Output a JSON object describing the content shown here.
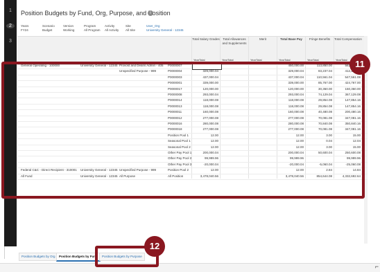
{
  "window": {
    "title": "Position Budgets by Fund, Org, Purpose, and Position"
  },
  "row_numbers": [
    "1",
    "2",
    "3"
  ],
  "pov": [
    {
      "h": "Years",
      "v": "FY24"
    },
    {
      "h": "Scenario",
      "v": "Budget"
    },
    {
      "h": "Version",
      "v": "Working"
    },
    {
      "h": "Program",
      "v": "All Program"
    },
    {
      "h": "Activity",
      "v": "All Activity"
    },
    {
      "h": "Site",
      "v": "All Site"
    },
    {
      "h": "User_Org",
      "v": "University General - 12345"
    }
  ],
  "columns": [
    {
      "label": "Total Salary Grades",
      "sub": "YearTotal"
    },
    {
      "label": "Total Allowances and Supplements",
      "sub": "YearTotal"
    },
    {
      "label": "Merit",
      "sub": "YearTotal"
    },
    {
      "label": "Total Base Pay",
      "sub": "YearTotal"
    },
    {
      "label": "Fringe Benefits",
      "sub": "YearTotal"
    },
    {
      "label": "Total Compensation",
      "sub": "YearTotal"
    }
  ],
  "rows": [
    {
      "fund": "General Operating - 100000",
      "org": "University General - 12345",
      "purpose": "Provost and Deans Admin - 405",
      "pos": "P0000007",
      "v": [
        "450,000",
        "",
        "",
        "450,000.00",
        "113,850.00",
        "563,850.00"
      ]
    },
    {
      "fund": "",
      "org": "",
      "purpose": "Unspecified Purpose - 999",
      "pos": "P0000004",
      "v": [
        "329,000.04",
        "",
        "",
        "329,000.04",
        "83,237.04",
        "412,237.08"
      ]
    },
    {
      "fund": "",
      "org": "",
      "purpose": "",
      "pos": "P0000003",
      "v": [
        "437,000.04",
        "",
        "",
        "437,000.04",
        "110,561.04",
        "547,561.08"
      ]
    },
    {
      "fund": "",
      "org": "",
      "purpose": "",
      "pos": "P0000001",
      "v": [
        "339,000.00",
        "",
        "",
        "339,000.00",
        "85,767.00",
        "424,767.00"
      ]
    },
    {
      "fund": "",
      "org": "",
      "purpose": "",
      "pos": "P0000017",
      "v": [
        "120,000.00",
        "",
        "",
        "120,000.00",
        "30,360.00",
        "150,360.00"
      ]
    },
    {
      "fund": "",
      "org": "",
      "purpose": "",
      "pos": "P0000008",
      "v": [
        "293,000.04",
        "",
        "",
        "293,000.04",
        "74,129.04",
        "367,129.08"
      ]
    },
    {
      "fund": "",
      "org": "",
      "purpose": "",
      "pos": "P0000014",
      "v": [
        "118,000.08",
        "",
        "",
        "118,000.08",
        "29,854.08",
        "147,854.16"
      ]
    },
    {
      "fund": "",
      "org": "",
      "purpose": "",
      "pos": "P0000013",
      "v": [
        "118,000.08",
        "",
        "",
        "118,000.08",
        "29,854.08",
        "147,854.16"
      ]
    },
    {
      "fund": "",
      "org": "",
      "purpose": "",
      "pos": "P0000011",
      "v": [
        "160,000.08",
        "",
        "",
        "160,000.08",
        "40,480.08",
        "200,480.16"
      ]
    },
    {
      "fund": "",
      "org": "",
      "purpose": "",
      "pos": "P0000012",
      "v": [
        "277,000.08",
        "",
        "",
        "277,000.08",
        "70,081.08",
        "347,081.16"
      ]
    },
    {
      "fund": "",
      "org": "",
      "purpose": "",
      "pos": "P0000016",
      "v": [
        "280,000.08",
        "",
        "",
        "280,000.08",
        "70,840.08",
        "350,840.16"
      ]
    },
    {
      "fund": "",
      "org": "",
      "purpose": "",
      "pos": "P0000018",
      "v": [
        "277,000.08",
        "",
        "",
        "277,000.08",
        "70,081.08",
        "347,081.16"
      ]
    },
    {
      "fund": "",
      "org": "",
      "purpose": "",
      "pos": "Position Pool 1",
      "v": [
        "12.00",
        "",
        "",
        "12.00",
        "3.00",
        "15.00"
      ]
    },
    {
      "fund": "",
      "org": "",
      "purpose": "",
      "pos": "Seasonal Pool 1",
      "v": [
        "12.00",
        "",
        "",
        "12.00",
        "0.04",
        "12.04"
      ]
    },
    {
      "fund": "",
      "org": "",
      "purpose": "",
      "pos": "Seasonal Pool 2",
      "v": [
        "12.00",
        "",
        "",
        "12.00",
        "3.00",
        "15.00"
      ]
    },
    {
      "fund": "",
      "org": "",
      "purpose": "",
      "pos": "Other Pay Pool 1",
      "v": [
        "200,000.04",
        "",
        "",
        "200,000.04",
        "50,600.04",
        "250,600.08"
      ]
    },
    {
      "fund": "",
      "org": "",
      "purpose": "",
      "pos": "Other Pay Pool 2",
      "v": [
        "99,999.96",
        "",
        "",
        "99,999.96",
        "",
        "99,999.96"
      ]
    },
    {
      "fund": "",
      "org": "",
      "purpose": "",
      "pos": "Other Pay Pool 3",
      "v": [
        "-20,000.04",
        "",
        "",
        "-20,000.04",
        "-5,060.04",
        "-25,060.08"
      ]
    },
    {
      "fund": "Federal C&C - Direct Recipient - 310001",
      "org": "University General - 12345",
      "purpose": "Unspecified Purpose - 999",
      "pos": "Position Pool 2",
      "v": [
        "12.00",
        "",
        "",
        "12.00",
        "2.84",
        "14.84"
      ]
    },
    {
      "fund": "All Fund",
      "org": "University General - 12345",
      "purpose": "All Purpose",
      "pos": "All Position",
      "v": [
        "3,478,040.56",
        "",
        "",
        "3,478,040.56",
        "854,644.08",
        "4,332,692.64"
      ]
    }
  ],
  "tabs": [
    {
      "label": "Position Budgets by Org",
      "active": false
    },
    {
      "label": "Position Budgets by Fund",
      "active": true
    },
    {
      "label": "Position Budgets by Purpose",
      "active": false
    }
  ],
  "callouts": [
    "11",
    "12"
  ],
  "colors": {
    "callout": "#8a1720",
    "link": "#2a6fb0"
  }
}
